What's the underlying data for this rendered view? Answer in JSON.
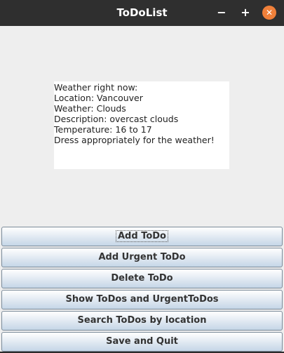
{
  "window": {
    "title": "ToDoList",
    "minimize_glyph": "−",
    "maximize_glyph": "+",
    "close_glyph": "✕"
  },
  "weather": {
    "lines": [
      "Weather right now:",
      "Location: Vancouver",
      "Weather: Clouds",
      "Description: overcast clouds",
      "Temperature: 16 to 17",
      "Dress appropriately for the weather!"
    ]
  },
  "buttons": [
    {
      "label": "Add ToDo"
    },
    {
      "label": "Add Urgent ToDo"
    },
    {
      "label": "Delete ToDo"
    },
    {
      "label": "Show ToDos and UrgentToDos"
    },
    {
      "label": "Search ToDos by location"
    },
    {
      "label": "Save and Quit"
    }
  ],
  "colors": {
    "titlebar": "#2f2f2f",
    "close_button": "#f0803a",
    "window_background": "#eeeeee"
  }
}
